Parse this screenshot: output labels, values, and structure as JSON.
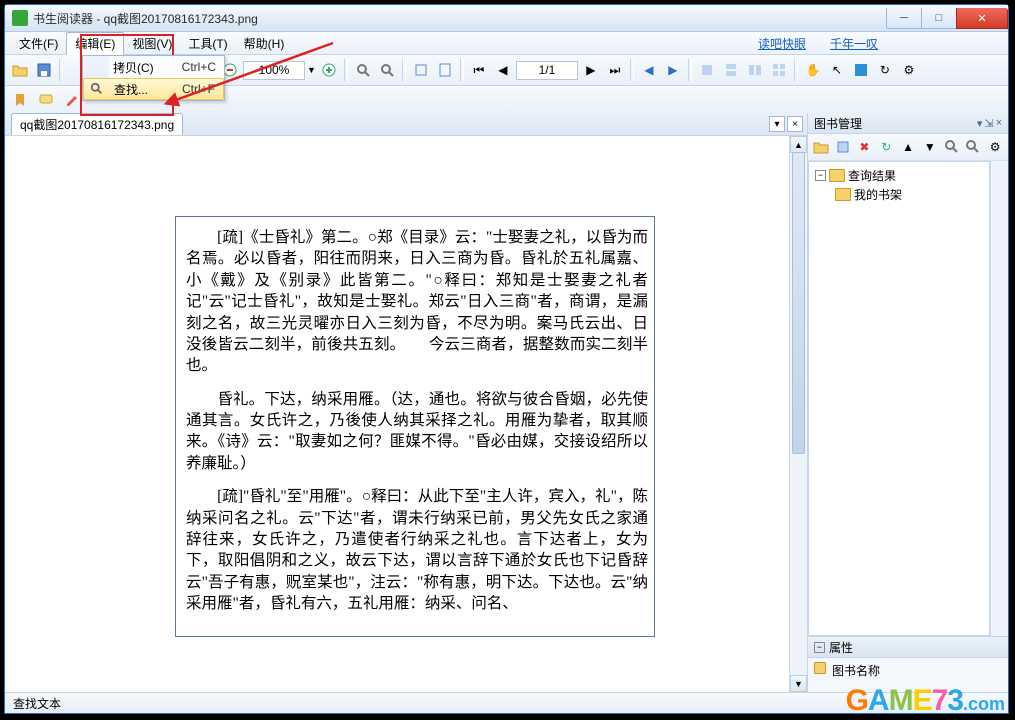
{
  "window": {
    "title": "书生阅读器 - qq截图20170816172343.png"
  },
  "menu": {
    "file": "文件(F)",
    "edit": "编辑(E)",
    "view": "视图(V)",
    "tools": "工具(T)",
    "help": "帮助(H)",
    "link1": "读吧快眼",
    "link2": "千年一叹"
  },
  "dropdown": {
    "copy": "拷贝(C)",
    "copy_short": "Ctrl+C",
    "find": "查找...",
    "find_short": "Ctrl+F"
  },
  "zoom": {
    "value": "100%"
  },
  "page_nav": {
    "value": "1/1"
  },
  "tab": {
    "label": "qq截图20170816172343.png"
  },
  "doc": {
    "p1": "　　[疏]《士昏礼》第二。○郑《目录》云：\"士娶妻之礼，以昏为而名焉。必以昏者，阳往而阴来，日入三商为昏。昏礼於五礼属嘉、小《戴》及《别录》此皆第二。\"○释曰：郑知是士娶妻之礼者记\"云\"记士昏礼\"，故知是士娶礼。郑云\"日入三商\"者，商谓，是漏刻之名，故三光灵曜亦日入三刻为昏，不尽为明。案马氏云出、日没後皆云二刻半，前後共五刻。　　今云三商者，据整数而实二刻半也。",
    "p2": "　　昏礼。下达，纳采用雁。（达，通也。将欲与彼合昏姻，必先使通其言。女氏许之，乃後使人纳其采择之礼。用雁为挚者，取其顺来。《诗》云：\"取妻如之何？匪媒不得。\"昏必由媒，交接设绍所以养廉耻。）",
    "p3": "　　[疏]\"昏礼\"至\"用雁\"。○释曰：从此下至\"主人许，宾入，礼\"，陈纳采问名之礼。云\"下达\"者，谓未行纳采已前，男父先女氏之家通辞往来，女氏许之，乃遣使者行纳采之礼也。言下达者上，女为下，取阳倡阴和之义，故云下达，谓以言辞下通於女氏也下记昏辞云\"吾子有惠，贶室某也\"，注云：\"称有惠，明下达。下达也。云\"纳采用雁\"者，昏礼有六，五礼用雁：纳采、问名、"
  },
  "side": {
    "title": "图书管理",
    "tree_root": "查询结果",
    "tree_shelf": "我的书架",
    "prop_title": "属性",
    "prop_col": "图书名称"
  },
  "status": {
    "text": "查找文本"
  },
  "watermark": {
    "text": "GAME73",
    "suffix": ".com"
  }
}
